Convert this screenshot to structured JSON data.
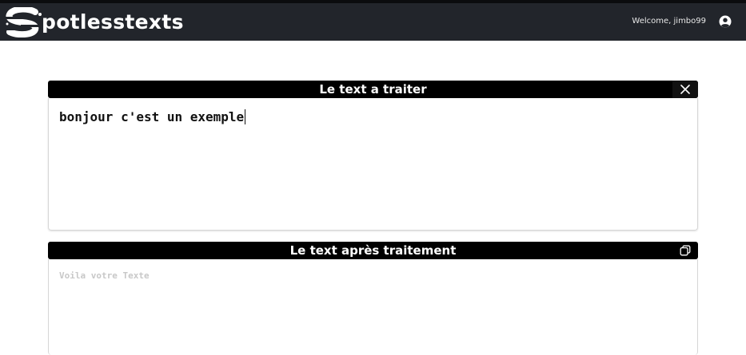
{
  "navbar": {
    "brand": "potlesstexts",
    "welcome": "Welcome, jimbo99",
    "logo_icon": "spotless-s-logo-icon",
    "user_icon": "user-circle-icon"
  },
  "input_panel": {
    "title": "Le text a traiter",
    "value": "bonjour c'est un exemple",
    "action_icon": "close-icon"
  },
  "output_panel": {
    "title": "Le text après traitement",
    "placeholder": "Voila votre Texte",
    "value": "",
    "action_icon": "copy-icon"
  },
  "colors": {
    "navbar_bg": "#22252b",
    "header_bg": "#000000",
    "text": "#111111",
    "placeholder": "#c8c8c8"
  }
}
